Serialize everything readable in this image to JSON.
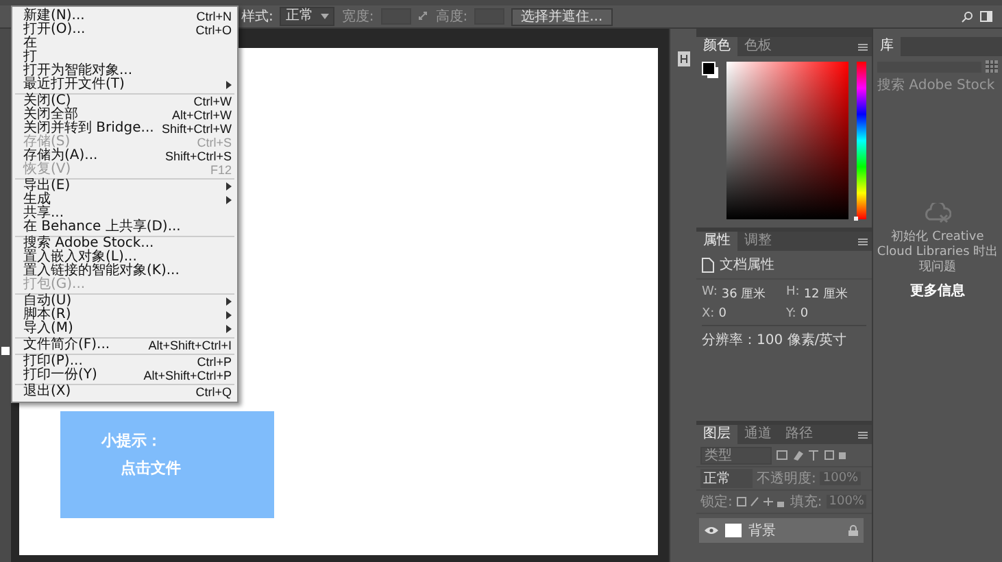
{
  "options_bar": {
    "style_label": "样式:",
    "style_value": "正常",
    "width_label": "宽度:",
    "height_label": "高度:",
    "button": "选择并遮住..."
  },
  "file_menu": {
    "groups": [
      [
        {
          "label": "新建(N)...",
          "shortcut": "Ctrl+N",
          "disabled": false,
          "submenu": false
        },
        {
          "label": "打开(O)...",
          "shortcut": "Ctrl+O",
          "disabled": false,
          "submenu": false
        },
        {
          "label": "在",
          "disabled": false,
          "submenu": false
        },
        {
          "label": "打",
          "disabled": false,
          "submenu": false
        },
        {
          "label": "打开为智能对象...",
          "disabled": false,
          "submenu": false
        },
        {
          "label": "最近打开文件(T)",
          "disabled": false,
          "submenu": true
        }
      ],
      [
        {
          "label": "关闭(C)",
          "shortcut": "Ctrl+W",
          "disabled": false,
          "submenu": false
        },
        {
          "label": "关闭全部",
          "shortcut": "Alt+Ctrl+W",
          "disabled": false,
          "submenu": false
        },
        {
          "label": "关闭并转到 Bridge...",
          "shortcut": "Shift+Ctrl+W",
          "disabled": false,
          "submenu": false
        },
        {
          "label": "存储(S)",
          "shortcut": "Ctrl+S",
          "disabled": true,
          "submenu": false
        },
        {
          "label": "存储为(A)...",
          "shortcut": "Shift+Ctrl+S",
          "disabled": false,
          "submenu": false
        },
        {
          "label": "恢复(V)",
          "shortcut": "F12",
          "disabled": true,
          "submenu": false
        }
      ],
      [
        {
          "label": "导出(E)",
          "disabled": false,
          "submenu": true
        },
        {
          "label": "生成",
          "disabled": false,
          "submenu": true
        },
        {
          "label": "共享...",
          "disabled": false,
          "submenu": false
        },
        {
          "label": "在 Behance 上共享(D)...",
          "disabled": false,
          "submenu": false
        }
      ],
      [
        {
          "label": "搜索 Adobe Stock...",
          "disabled": false,
          "submenu": false
        },
        {
          "label": "置入嵌入对象(L)...",
          "disabled": false,
          "submenu": false
        },
        {
          "label": "置入链接的智能对象(K)...",
          "disabled": false,
          "submenu": false
        },
        {
          "label": "打包(G)...",
          "disabled": true,
          "submenu": false
        }
      ],
      [
        {
          "label": "自动(U)",
          "disabled": false,
          "submenu": true
        },
        {
          "label": "脚本(R)",
          "disabled": false,
          "submenu": true
        },
        {
          "label": "导入(M)",
          "disabled": false,
          "submenu": true
        }
      ],
      [
        {
          "label": "文件简介(F)...",
          "shortcut": "Alt+Shift+Ctrl+I",
          "disabled": false,
          "submenu": false
        }
      ],
      [
        {
          "label": "打印(P)...",
          "shortcut": "Ctrl+P",
          "disabled": false,
          "submenu": false
        },
        {
          "label": "打印一份(Y)",
          "shortcut": "Alt+Shift+Ctrl+P",
          "disabled": false,
          "submenu": false
        }
      ],
      [
        {
          "label": "退出(X)",
          "shortcut": "Ctrl+Q",
          "disabled": false,
          "submenu": false
        }
      ]
    ]
  },
  "tip": {
    "title": "小提示：",
    "text": "点击文件"
  },
  "color_panel": {
    "hue_slider": {
      "level": 0
    },
    "tabs": [
      {
        "label": "颜色",
        "selected": true
      },
      {
        "label": "色板",
        "selected": false
      }
    ]
  },
  "properties_panel": {
    "tabs": [
      {
        "label": "属性",
        "selected": true
      },
      {
        "label": "调整",
        "selected": false
      }
    ],
    "title": "文档属性",
    "fields": [
      {
        "label": "W:",
        "value": "36 厘米"
      },
      {
        "label": "H:",
        "value": "12 厘米"
      },
      {
        "label": "X:",
        "value": "0"
      },
      {
        "label": "Y:",
        "value": "0"
      }
    ],
    "resolution": "分辨率：100 像素/英寸"
  },
  "layers_panel": {
    "tabs": [
      {
        "label": "图层",
        "selected": true
      },
      {
        "label": "通道",
        "selected": false
      },
      {
        "label": "路径",
        "selected": false
      }
    ],
    "filter_placeholder": "类型",
    "blend_mode": "正常",
    "opacity_label": "不透明度:",
    "opacity_value": "100%",
    "lock_label": "锁定:",
    "fill_label": "填充:",
    "fill_value": "100%",
    "layers": [
      {
        "name": "背景",
        "visible": true,
        "locked": true
      }
    ]
  },
  "libraries_panel": {
    "tabs": [
      {
        "label": "库",
        "selected": true
      }
    ],
    "search_placeholder": "搜索 Adobe Stock",
    "message": "初始化 Creative Cloud Libraries 时出现问题",
    "link": "更多信息"
  }
}
